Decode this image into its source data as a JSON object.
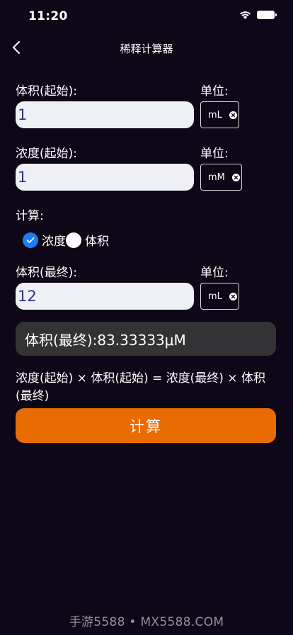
{
  "status_bar": {
    "time": "11:20"
  },
  "nav": {
    "title": "稀释计算器"
  },
  "volume_start": {
    "label": "体积(起始):",
    "unit_label": "单位:",
    "value": "1",
    "unit": "mL"
  },
  "conc_start": {
    "label": "浓度(起始):",
    "unit_label": "单位:",
    "value": "1",
    "unit": "mM"
  },
  "compute": {
    "label": "计算:",
    "options": [
      {
        "label": "浓度",
        "selected": true
      },
      {
        "label": "体积",
        "selected": false
      }
    ]
  },
  "volume_final": {
    "label": "体积(最终):",
    "unit_label": "单位:",
    "value": "12",
    "unit": "mL"
  },
  "result": {
    "text": "体积(最终):83.33333μM"
  },
  "formula": {
    "text": "浓度(起始) × 体积(起始) = 浓度(最终) × 体积(最终)"
  },
  "button": {
    "label": "计算"
  },
  "watermark": "手游5588 • MX5588.COM",
  "colors": {
    "background": "#0e0717",
    "accent": "#ea6b02",
    "radio": "#1e7cf2",
    "input_text": "#33308a"
  }
}
